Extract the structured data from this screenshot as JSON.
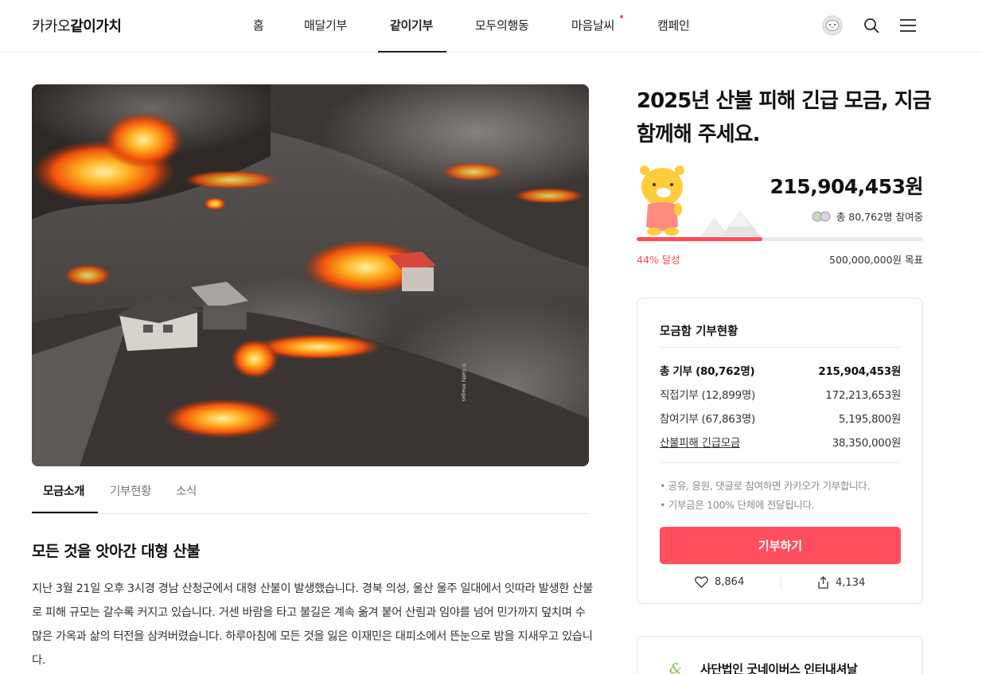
{
  "header": {
    "logo_plain": "카카오",
    "logo_bold": "같이가치",
    "nav": [
      "홈",
      "매달기부",
      "같이기부",
      "모두의행동",
      "마음날씨",
      "캠페인"
    ],
    "active_nav": "같이기부",
    "icons": [
      "avatar-icon",
      "search-icon",
      "menu-icon"
    ]
  },
  "hero": {
    "credit": "© Getty Images"
  },
  "tabs": [
    "모금소개",
    "기부현황",
    "소식"
  ],
  "story": {
    "title": "모든 것을 앗아간 대형 산불",
    "body": "지난 3월 21일 오후 3시경 경남 산청군에서 대형 산불이 발생했습니다. 경북 의성, 울산 울주 일대에서 잇따라 발생한 산불로 피해 규모는 갈수록 커지고 있습니다. 거센 바람을 타고 불길은 계속 옮겨 붙어 산림과 임야를 넘어 민가까지 덮치며 수많은 가옥과 삶의 터전을 삼켜버렸습니다. 하루아침에 모든 것을 잃은 이재민은 대피소에서 뜬눈으로 밤을 지새우고 있습니다."
  },
  "campaign": {
    "title": "2025년 산불 피해 긴급 모금, 지금 함께해 주세요.",
    "total": "215,904,453원",
    "participants": "총 80,762명 참여중",
    "progress_fraction": 0.44,
    "progress_label": "44% 달성",
    "goal": "500,000,000원 목표"
  },
  "status_card": {
    "title": "모금함 기부현황",
    "rows": [
      {
        "label": "총 기부 (80,762명)",
        "value": "215,904,453원"
      },
      {
        "label": "직접기부 (12,899명)",
        "value": "172,213,653원"
      },
      {
        "label": "참여기부 (67,863명)",
        "value": "5,195,800원"
      },
      {
        "label": "산불피해 긴급모금",
        "value": "38,350,000원"
      }
    ],
    "notes": [
      "• 공유, 응원, 댓글로 참여하면 카카오가 기부합니다.",
      "• 기부금은 100% 단체에 전달됩니다."
    ],
    "donate_label": "기부하기",
    "likes": "8,864",
    "shares": "4,134"
  },
  "org": {
    "logo": "&",
    "name": "사단법인 굿네이버스 인터내셔날"
  },
  "colors": {
    "accent": "#ff4a5a",
    "button": "#ff4f5e"
  }
}
